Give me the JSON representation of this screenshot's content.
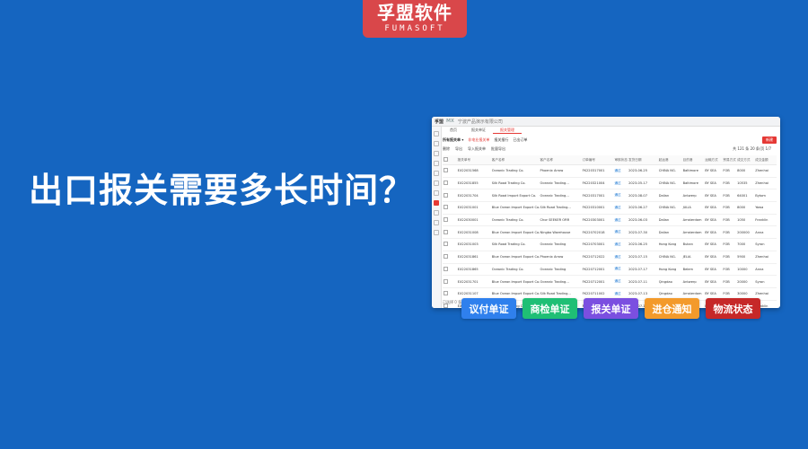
{
  "logo": {
    "cn": "孚盟软件",
    "en": "FUMASOFT"
  },
  "headline": "出口报关需要多长时间？",
  "colors": {
    "background": "#1565c0",
    "logo_bg": "#d9474a",
    "accent": "#e53935"
  },
  "screenshot": {
    "brand": "孚盟",
    "brand_mx": "MX",
    "company": "宁波产品演示有限公司",
    "tabs": [
      "首页",
      "报关单证",
      "报关管理"
    ],
    "active_tab": 2,
    "selector": "所有报关单 ▾",
    "filters": [
      "非电业报关单",
      "报关报行",
      "已出订单"
    ],
    "new_button": "新建",
    "toolbar": [
      "删除",
      "导出",
      "导入报关单",
      "批量导出"
    ],
    "pager": "共 121 条  20 条/页  1/7",
    "columns": [
      "报关单号",
      "客户名称",
      "客户名称",
      "订单编号",
      "审核状态",
      "发货日期",
      "起运港",
      "目的港",
      "运输方式",
      "贸易方式",
      "成交方式",
      "成交金额",
      "经营单位"
    ],
    "rows": [
      [
        "EX22031568",
        "Oceanic Trading Co.",
        "Phoenix Arrow",
        "FK220317001",
        "通过",
        "2023-06-25",
        "CHINA NG.",
        "Baltimore",
        "BY SEA",
        "FOB",
        "8000",
        "Zhenhai"
      ],
      [
        "EX22031855",
        "Silk Road Trading Co.",
        "Oceanic Trading...",
        "FK220321004",
        "通过",
        "2023-05-17",
        "CHINA NG.",
        "Baltimore",
        "BY SEA",
        "FOB",
        "10535",
        "Zhenhai"
      ],
      [
        "EX22031704",
        "Silk Road Import Export Co.",
        "Oceanic Trading...",
        "FK220317001",
        "通过",
        "2023-08-07",
        "Dalian",
        "Antwerp",
        "BY SEA",
        "FOB",
        "64001",
        "Bytom"
      ],
      [
        "EX22031001",
        "Blue Ocean Import Export Co.",
        "Silk Road Trading...",
        "FK220310001",
        "通过",
        "2023-06-27",
        "CHINA NG.",
        "JULIA",
        "BY SEA",
        "FOB",
        "8000",
        "Yawa"
      ],
      [
        "EX22030001",
        "Oceanic Trading Co.",
        "Chor SEEKER ORR",
        "FK220303001",
        "通过",
        "2023-06-03",
        "Dalian",
        "Amsterdam",
        "BY SEA",
        "FOB",
        "1050",
        "Franklin"
      ],
      [
        "EX22031008",
        "Blue Ocean Import Export Co.",
        "Ningbo Warehouse",
        "FK220702018",
        "通过",
        "2023-07-30",
        "Dalian",
        "Amsterdam",
        "BY SEA",
        "FOB",
        "200000",
        "Anna"
      ],
      [
        "EX22031003",
        "Silk Road Trading Co.",
        "Oceanic Trading",
        "FK220703001",
        "通过",
        "2023-06-25",
        "Hong Kong",
        "Bukan",
        "BY SEA",
        "FOB",
        "7000",
        "Syron"
      ],
      [
        "EX22031861",
        "Blue Ocean Import Export Co.",
        "Phoenix Arrow",
        "FK220712022",
        "通过",
        "2023-07-15",
        "CHINA NG.",
        "JELIA",
        "BY SEA",
        "FOB",
        "5900",
        "Zhenhai"
      ],
      [
        "EX22031865",
        "Oceanic Trading Co.",
        "Oceanic Trading",
        "FK220712001",
        "通过",
        "2023-07-17",
        "Hong Kong",
        "Belem",
        "BY SEA",
        "FOB",
        "10000",
        "Anna"
      ],
      [
        "EX22031701",
        "Blue Ocean Import Export Co.",
        "Oceanic Trading...",
        "FK220712001",
        "通过",
        "2023-07-11",
        "Qingdao",
        "Antwerp",
        "BY SEA",
        "FOB",
        "20000",
        "Syron"
      ],
      [
        "EX22031107",
        "Blue Ocean Import Export Co.",
        "Silk Road Trading...",
        "FK220711002",
        "通过",
        "2023-07-13",
        "Qingdao",
        "Amsterdam",
        "BY SEA",
        "FOB",
        "30000",
        "Zhenhai"
      ],
      [
        "EX22031002",
        "Silk Road Trading Co.",
        "Visit SEEKER ORR",
        "FK220712001",
        "通过",
        "2023-07-13",
        "Hong Kong",
        "Belem",
        "BY SEA",
        "FOB",
        "30000",
        "Franklin"
      ]
    ],
    "footer": "已选择 0 条"
  },
  "buttons": [
    {
      "label": "议付单证",
      "color": "#2f80ed"
    },
    {
      "label": "商检单证",
      "color": "#1fbf75"
    },
    {
      "label": "报关单证",
      "color": "#7b4fe0"
    },
    {
      "label": "进仓通知",
      "color": "#f39a2b"
    },
    {
      "label": "物流状态",
      "color": "#c62828"
    }
  ]
}
